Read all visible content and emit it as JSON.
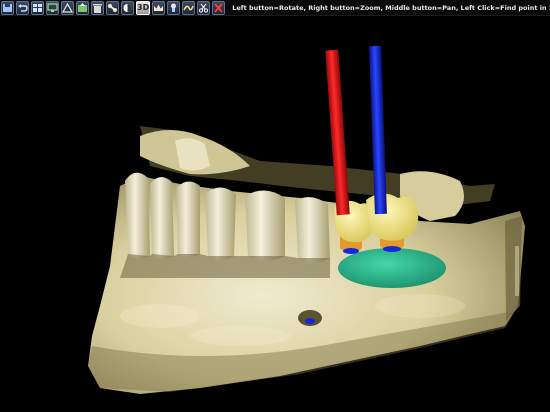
{
  "toolbar": {
    "buttons": [
      {
        "icon": "save-icon"
      },
      {
        "icon": "undo-icon"
      },
      {
        "icon": "layout-icon"
      },
      {
        "icon": "screen-icon"
      },
      {
        "icon": "measure-angle-icon"
      },
      {
        "icon": "export-icon"
      },
      {
        "icon": "trash-icon"
      },
      {
        "icon": "bone-icon"
      },
      {
        "icon": "contrast-icon"
      },
      {
        "icon": "3d-icon",
        "label": "3D",
        "active": true
      },
      {
        "icon": "crown-icon"
      },
      {
        "icon": "implant-icon"
      },
      {
        "icon": "nerve-icon"
      },
      {
        "icon": "cut-icon"
      },
      {
        "icon": "close-icon"
      }
    ],
    "status_text": "Left button=Rotate, Right button=Zoom, Middle button=Pan, Left Click=Find point in 2D"
  },
  "colors": {
    "bone": "#e9e2c2",
    "implant_red": "#e0141a",
    "implant_blue": "#1428d8",
    "crown": "#efe48a",
    "gum": "#27b28a"
  }
}
